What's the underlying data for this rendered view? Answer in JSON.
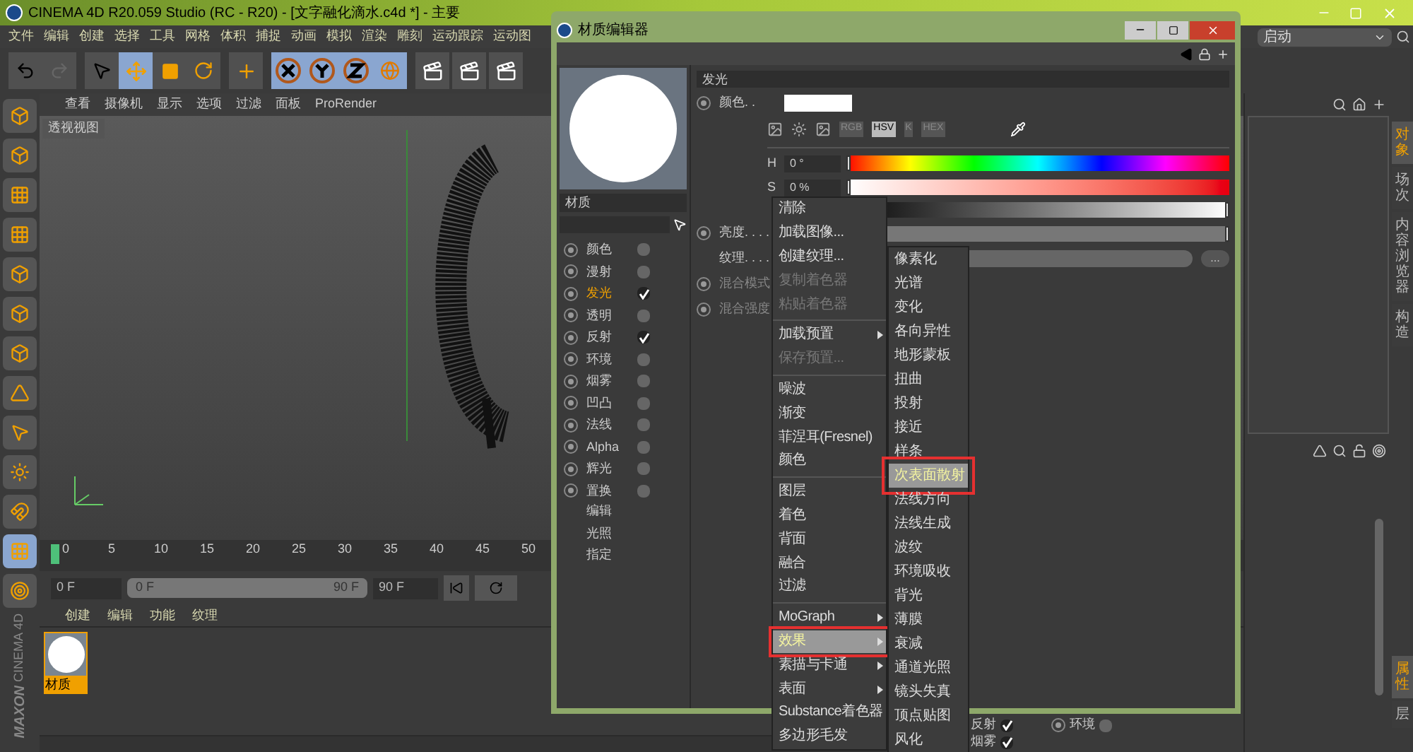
{
  "window": {
    "title": "CINEMA 4D R20.059 Studio (RC - R20) - [文字融化滴水.c4d *] - 主要"
  },
  "menu_bar": [
    "文件",
    "编辑",
    "创建",
    "选择",
    "工具",
    "网格",
    "体积",
    "捕捉",
    "动画",
    "模拟",
    "渲染",
    "雕刻",
    "运动跟踪",
    "运动图"
  ],
  "layout_selector": {
    "value": "启动"
  },
  "viewport": {
    "menu": [
      "查看",
      "摄像机",
      "显示",
      "选项",
      "过滤",
      "面板",
      "ProRender"
    ],
    "label": "透视视图"
  },
  "timeline": {
    "ticks": [
      "0",
      "5",
      "10",
      "15",
      "20",
      "25",
      "30",
      "35",
      "40",
      "45",
      "50"
    ],
    "start_field": "0 F",
    "range_start": "0 F",
    "range_end": "90 F",
    "end_field": "90 F",
    "range_slider": {
      "level": 1
    }
  },
  "material_manager": {
    "menu": [
      "创建",
      "编辑",
      "功能",
      "纹理"
    ],
    "materials": [
      {
        "name": "材质",
        "selected": true
      }
    ]
  },
  "brand": {
    "company": "MAXON",
    "product": "CINEMA 4D"
  },
  "object_tabs": [
    {
      "label": "对象",
      "selected": true
    },
    {
      "label": "场次",
      "selected": false
    },
    {
      "label": "内容浏览器",
      "selected": false
    },
    {
      "label": "构造",
      "selected": false
    }
  ],
  "attribute_tabs": [
    {
      "label": "属性",
      "selected": true
    },
    {
      "label": "层",
      "selected": false
    }
  ],
  "background_options": [
    {
      "label": "反射",
      "checked": true
    },
    {
      "label": "环境",
      "checked": false
    },
    {
      "label": "烟雾",
      "checked": true
    }
  ],
  "material_editor": {
    "title": "材质编辑器",
    "material_name": "材质",
    "channels": [
      {
        "kind": "channel",
        "label": "颜色",
        "checked": false,
        "selected": false
      },
      {
        "kind": "channel",
        "label": "漫射",
        "checked": false,
        "selected": false
      },
      {
        "kind": "channel",
        "label": "发光",
        "checked": true,
        "selected": true
      },
      {
        "kind": "channel",
        "label": "透明",
        "checked": false,
        "selected": false
      },
      {
        "kind": "channel",
        "label": "反射",
        "checked": true,
        "selected": false
      },
      {
        "kind": "channel",
        "label": "环境",
        "checked": false,
        "selected": false
      },
      {
        "kind": "channel",
        "label": "烟雾",
        "checked": false,
        "selected": false
      },
      {
        "kind": "channel",
        "label": "凹凸",
        "checked": false,
        "selected": false
      },
      {
        "kind": "channel",
        "label": "法线",
        "checked": false,
        "selected": false
      },
      {
        "kind": "channel",
        "label": "Alpha",
        "checked": false,
        "selected": false
      },
      {
        "kind": "channel",
        "label": "辉光",
        "checked": false,
        "selected": false
      },
      {
        "kind": "channel",
        "label": "置换",
        "checked": false,
        "selected": false
      },
      {
        "kind": "page",
        "label": "编辑",
        "selected": false
      },
      {
        "kind": "page",
        "label": "光照",
        "selected": false
      },
      {
        "kind": "page",
        "label": "指定",
        "selected": false
      }
    ],
    "section_title": "发光",
    "color_label": "颜色. .",
    "color_modes": [
      {
        "label": "RGB",
        "selected": false
      },
      {
        "label": "HSV",
        "selected": true
      },
      {
        "label": "K",
        "selected": false
      },
      {
        "label": "HEX",
        "selected": false
      }
    ],
    "hue": {
      "label": "H",
      "value": "0 °",
      "level": 0
    },
    "saturation": {
      "label": "S",
      "value": "0 %",
      "level": 0
    },
    "value_slider": {
      "level": 1
    },
    "brightness": {
      "label": "亮度. . . .",
      "level": 1
    },
    "texture_label": "纹理. . . .",
    "texture_button": "...",
    "blend_mode_label": "混合模式",
    "blend_strength_label": "混合强度"
  },
  "context_menu": [
    {
      "kind": "item",
      "label": "清除",
      "disabled": false,
      "submenu": false,
      "selected": false
    },
    {
      "kind": "item",
      "label": "加载图像...",
      "disabled": false,
      "submenu": false,
      "selected": false
    },
    {
      "kind": "item",
      "label": "创建纹理...",
      "disabled": false,
      "submenu": false,
      "selected": false
    },
    {
      "kind": "item",
      "label": "复制着色器",
      "disabled": true,
      "submenu": false,
      "selected": false
    },
    {
      "kind": "item",
      "label": "粘贴着色器",
      "disabled": true,
      "submenu": false,
      "selected": false
    },
    {
      "kind": "separator"
    },
    {
      "kind": "item",
      "label": "加载预置",
      "disabled": false,
      "submenu": true,
      "selected": false
    },
    {
      "kind": "item",
      "label": "保存预置...",
      "disabled": true,
      "submenu": false,
      "selected": false
    },
    {
      "kind": "separator"
    },
    {
      "kind": "item",
      "label": "噪波",
      "disabled": false,
      "submenu": false,
      "selected": false
    },
    {
      "kind": "item",
      "label": "渐变",
      "disabled": false,
      "submenu": false,
      "selected": false
    },
    {
      "kind": "item",
      "label": "菲涅耳(Fresnel)",
      "disabled": false,
      "submenu": false,
      "selected": false
    },
    {
      "kind": "item",
      "label": "颜色",
      "disabled": false,
      "submenu": false,
      "selected": false
    },
    {
      "kind": "separator"
    },
    {
      "kind": "item",
      "label": "图层",
      "disabled": false,
      "submenu": false,
      "selected": false
    },
    {
      "kind": "item",
      "label": "着色",
      "disabled": false,
      "submenu": false,
      "selected": false
    },
    {
      "kind": "item",
      "label": "背面",
      "disabled": false,
      "submenu": false,
      "selected": false
    },
    {
      "kind": "item",
      "label": "融合",
      "disabled": false,
      "submenu": false,
      "selected": false
    },
    {
      "kind": "item",
      "label": "过滤",
      "disabled": false,
      "submenu": false,
      "selected": false
    },
    {
      "kind": "separator"
    },
    {
      "kind": "item",
      "label": "MoGraph",
      "disabled": false,
      "submenu": true,
      "selected": false
    },
    {
      "kind": "item",
      "label": "效果",
      "disabled": false,
      "submenu": true,
      "selected": true
    },
    {
      "kind": "item",
      "label": "素描与卡通",
      "disabled": false,
      "submenu": true,
      "selected": false
    },
    {
      "kind": "item",
      "label": "表面",
      "disabled": false,
      "submenu": true,
      "selected": false
    },
    {
      "kind": "item",
      "label": "Substance着色器",
      "disabled": false,
      "submenu": false,
      "selected": false
    },
    {
      "kind": "item",
      "label": "多边形毛发",
      "disabled": false,
      "submenu": false,
      "selected": false
    }
  ],
  "submenu": [
    {
      "label": "像素化",
      "selected": false
    },
    {
      "label": "光谱",
      "selected": false
    },
    {
      "label": "变化",
      "selected": false
    },
    {
      "label": "各向异性",
      "selected": false
    },
    {
      "label": "地形蒙板",
      "selected": false
    },
    {
      "label": "扭曲",
      "selected": false
    },
    {
      "label": "投射",
      "selected": false
    },
    {
      "label": "接近",
      "selected": false
    },
    {
      "label": "样条",
      "selected": false
    },
    {
      "label": "次表面散射",
      "selected": true
    },
    {
      "label": "法线方向",
      "selected": false
    },
    {
      "label": "法线生成",
      "selected": false
    },
    {
      "label": "波纹",
      "selected": false
    },
    {
      "label": "环境吸收",
      "selected": false
    },
    {
      "label": "背光",
      "selected": false
    },
    {
      "label": "薄膜",
      "selected": false
    },
    {
      "label": "衰减",
      "selected": false
    },
    {
      "label": "通道光照",
      "selected": false
    },
    {
      "label": "镜头失真",
      "selected": false
    },
    {
      "label": "顶点贴图",
      "selected": false
    },
    {
      "label": "风化",
      "selected": false
    }
  ]
}
